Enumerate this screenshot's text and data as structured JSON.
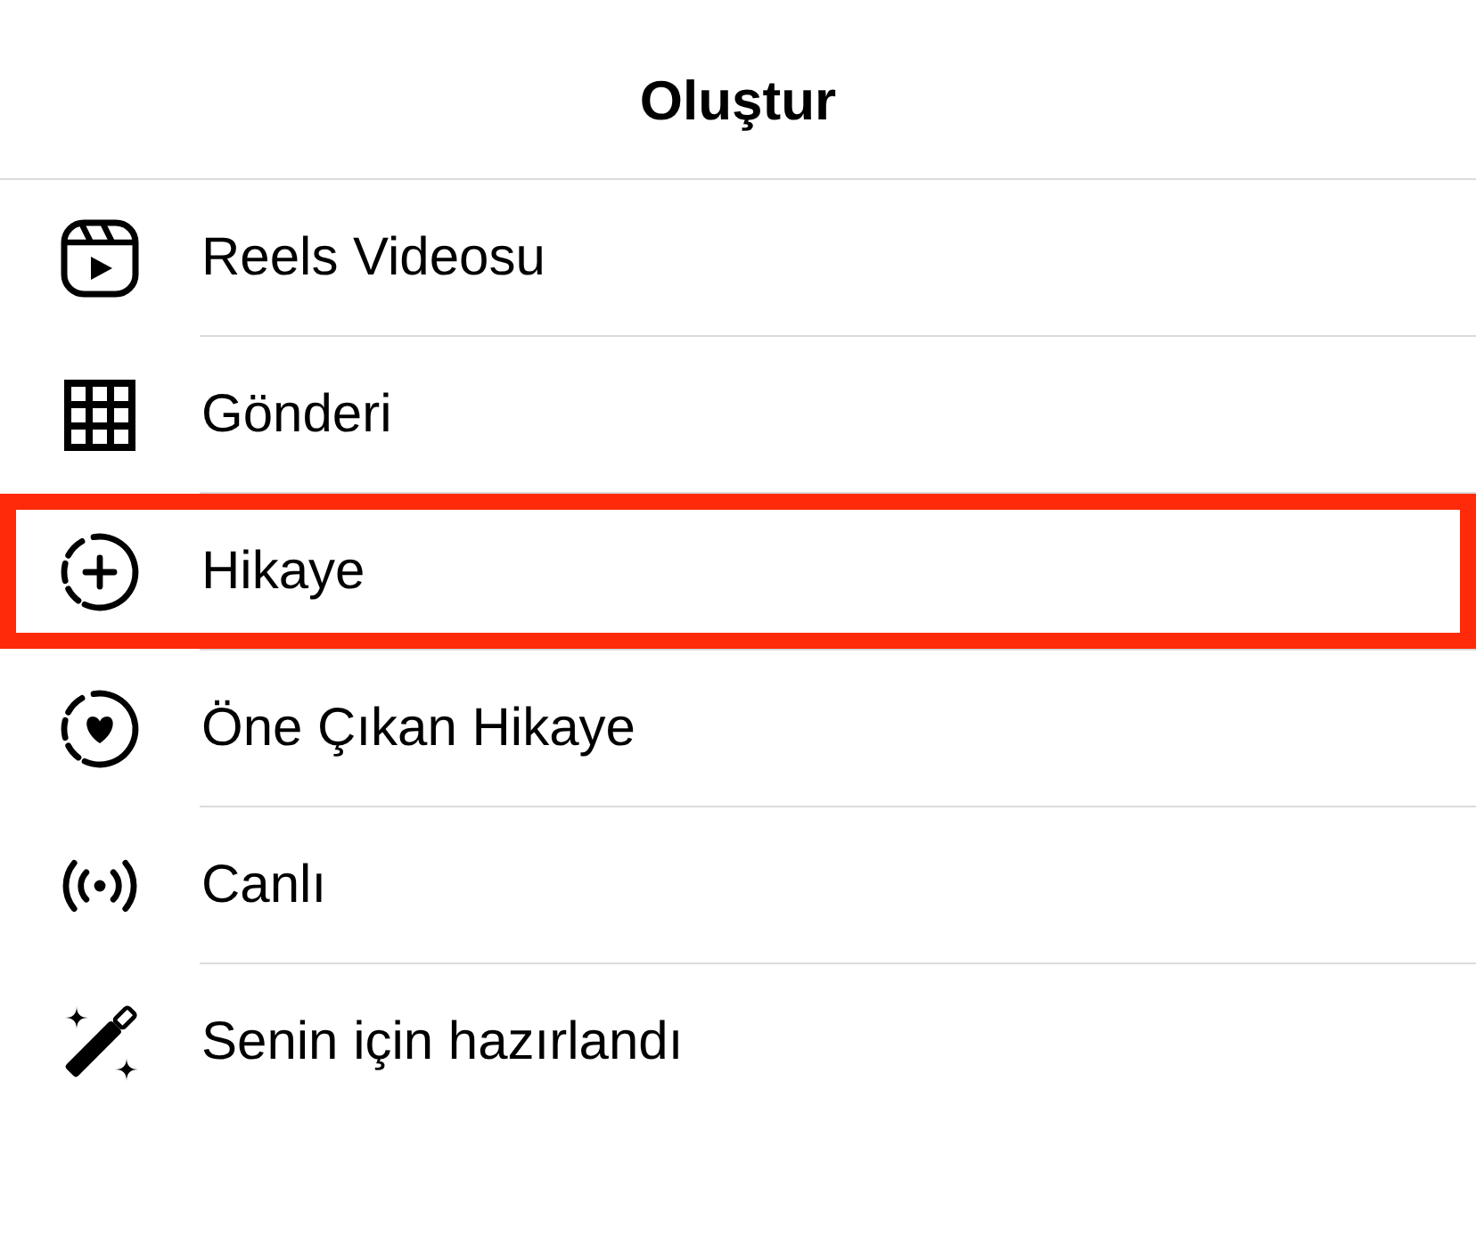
{
  "header": {
    "title": "Oluştur"
  },
  "items": [
    {
      "kind": "reels",
      "label": "Reels Videosu",
      "selected": false
    },
    {
      "kind": "grid",
      "label": "Gönderi",
      "selected": false
    },
    {
      "kind": "story",
      "label": "Hikaye",
      "selected": true
    },
    {
      "kind": "highlight",
      "label": "Öne Çıkan Hikaye",
      "selected": false
    },
    {
      "kind": "live",
      "label": "Canlı",
      "selected": false
    },
    {
      "kind": "wand",
      "label": "Senin için hazırlandı",
      "selected": false
    }
  ]
}
